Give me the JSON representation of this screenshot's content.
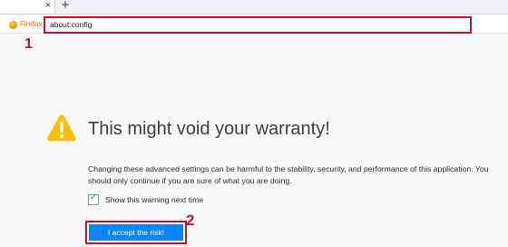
{
  "browser": {
    "tab_label": "Firefox",
    "close_glyph": "×",
    "new_tab_glyph": "+",
    "url": "about:config",
    "brand_color": "#ff5c00"
  },
  "annotations": {
    "marker_1": "1",
    "marker_2": "2",
    "highlight_color": "#c8102e"
  },
  "warning": {
    "icon": "warning-triangle-icon",
    "title": "This might void your warranty!",
    "description": "Changing these advanced settings can be harmful to the stability, security, and performance of this application. You should only continue if you are sure of what you are doing.",
    "checkbox_label": "Show this warning next time",
    "checkbox_checked": true,
    "accept_label": "I accept the risk!",
    "accent_color": "#0a84ff"
  }
}
